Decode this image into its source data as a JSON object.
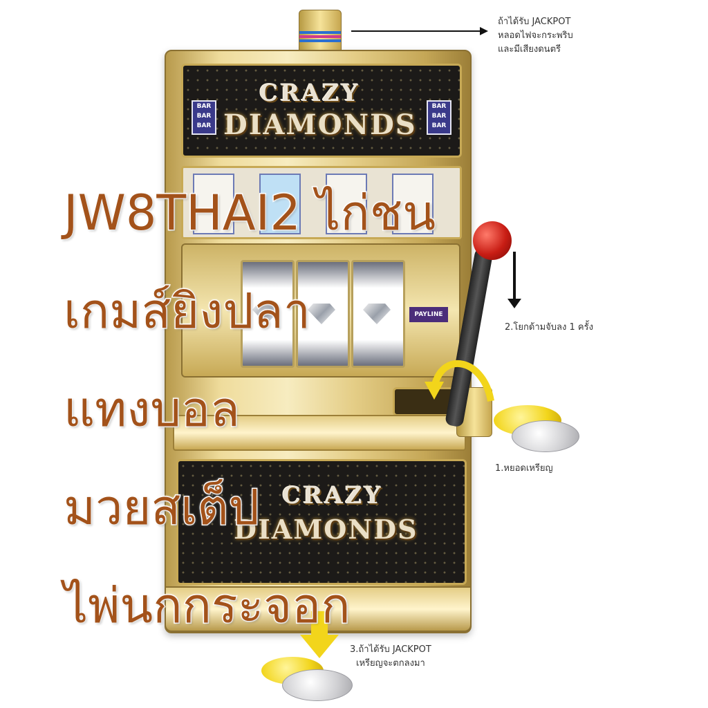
{
  "machine": {
    "logo_top": {
      "line1": "CRAZY",
      "line2": "DIAMONDS"
    },
    "logo_bottom": {
      "line1": "CRAZY",
      "line2": "DIAMONDS"
    },
    "bar_badge": "BAR\nBAR\nBAR",
    "payline_label": "PAYLINE"
  },
  "annotations": {
    "jackpot_light": [
      "ถ้าได้รับ JACKPOT",
      "หลอดไฟจะกระพริบ",
      "และมีเสียงดนตรี"
    ],
    "step2": "2.โยกด้ามจับลง 1 ครั้ง",
    "step1": "1.หยอดเหรียญ",
    "step3": [
      "3.ถ้าได้รับ JACKPOT",
      "เหรียญจะตกลงมา"
    ]
  },
  "headline": [
    "JW8THAI2 ไก่ชน",
    "เกมส์ยิงปลา",
    "แทงบอล",
    "มวยสเต็ป",
    "ไพ่นกกระจอก"
  ],
  "colors": {
    "headline": "#a3521a",
    "headline_outline": "#ffffff",
    "gold": "#e4cd86",
    "lever_ball": "#c81d14",
    "coin_gold": "#f2d51b"
  }
}
